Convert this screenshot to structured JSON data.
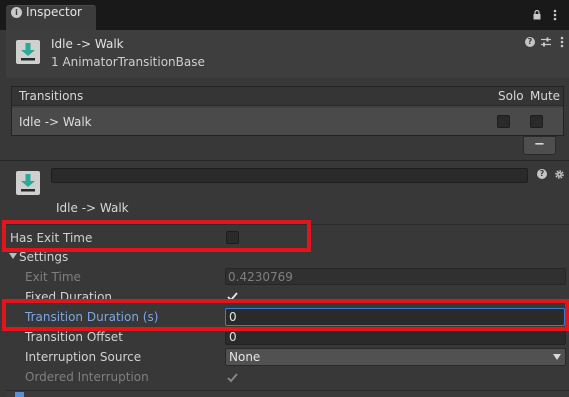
{
  "window": {
    "tab_title": "Inspector",
    "tab_icon": "info-icon",
    "lock_icon": "lock-icon",
    "menu_icon": "kebab-menu-icon"
  },
  "header": {
    "title": "Idle -> Walk",
    "subtitle": "1 AnimatorTransitionBase",
    "icon": "animator-transition-icon",
    "help_icon": "help-icon",
    "presets_icon": "presets-icon",
    "menu_icon": "kebab-menu-icon"
  },
  "transitions_list": {
    "header": "Transitions",
    "solo_header": "Solo",
    "mute_header": "Mute",
    "rows": [
      {
        "name": "Idle -> Walk",
        "solo": false,
        "mute": false
      }
    ],
    "remove_button_label": "−"
  },
  "transition": {
    "name_field_value": "",
    "display_name": "Idle -> Walk",
    "icon": "animator-transition-icon",
    "help_icon": "help-icon",
    "settings_icon": "gear-icon"
  },
  "properties": {
    "has_exit_time": {
      "label": "Has Exit Time",
      "checked": false
    },
    "settings_section": {
      "label": "Settings",
      "expanded": true
    },
    "exit_time": {
      "label": "Exit Time",
      "value": "0.4230769",
      "disabled": true
    },
    "fixed_duration": {
      "label": "Fixed Duration",
      "checked": true
    },
    "transition_duration": {
      "label": "Transition Duration (s)",
      "value": "0",
      "focused": true
    },
    "transition_offset": {
      "label": "Transition Offset",
      "value": "0"
    },
    "interruption_source": {
      "label": "Interruption Source",
      "value": "None"
    },
    "ordered_interruption": {
      "label": "Ordered Interruption",
      "checked": true,
      "disabled": true
    }
  },
  "colors": {
    "highlight": "#e2141c",
    "focus_accent": "#3d7bd0",
    "focused_label": "#7ba8e0",
    "panel_bg": "#383838"
  }
}
